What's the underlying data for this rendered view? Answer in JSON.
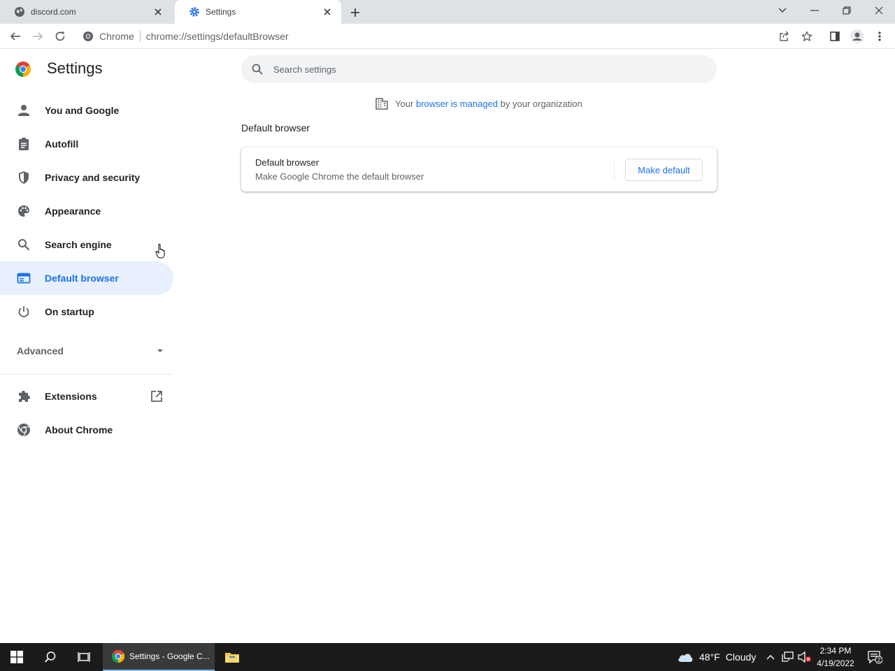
{
  "browser": {
    "tabs": [
      {
        "title": "discord.com",
        "active": false
      },
      {
        "title": "Settings",
        "active": true
      }
    ],
    "omnibox": {
      "chip": "Chrome",
      "url": "chrome://settings/defaultBrowser"
    }
  },
  "settings": {
    "title": "Settings",
    "search_placeholder": "Search settings",
    "nav": [
      {
        "label": "You and Google",
        "icon": "person-icon"
      },
      {
        "label": "Autofill",
        "icon": "clipboard-icon"
      },
      {
        "label": "Privacy and security",
        "icon": "shield-icon"
      },
      {
        "label": "Appearance",
        "icon": "palette-icon"
      },
      {
        "label": "Search engine",
        "icon": "search-icon"
      },
      {
        "label": "Default browser",
        "icon": "browser-window-icon",
        "active": true
      },
      {
        "label": "On startup",
        "icon": "power-icon"
      }
    ],
    "advanced_label": "Advanced",
    "nav_bottom": [
      {
        "label": "Extensions",
        "icon": "puzzle-icon"
      },
      {
        "label": "About Chrome",
        "icon": "chrome-icon"
      }
    ],
    "managed_notice": {
      "prefix": "Your",
      "link1": "browser",
      "mid": "is",
      "link2": "managed",
      "suffix": "by your organization"
    },
    "section_title": "Default browser",
    "card": {
      "title": "Default browser",
      "subtitle": "Make Google Chrome the default browser",
      "button": "Make default"
    }
  },
  "taskbar": {
    "chrome_label": "Settings - Google C...",
    "weather": {
      "temp": "48°F",
      "condition": "Cloudy"
    },
    "time": "2:34 PM",
    "date": "4/19/2022",
    "notifications": "2"
  },
  "colors": {
    "accent": "#1a73e8",
    "active_nav_bg": "#e8f0fe",
    "tabstrip": "#dee1e6",
    "taskbar": "#1b1b1b"
  }
}
